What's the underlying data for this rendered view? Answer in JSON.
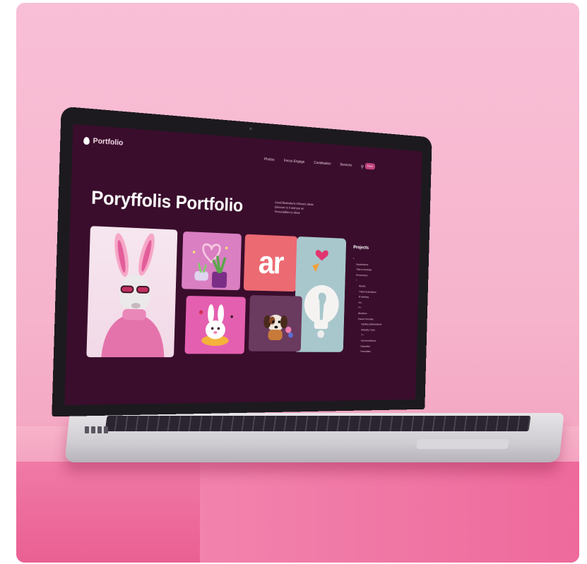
{
  "site": {
    "brand": "Portfolio",
    "nav": [
      "Photos",
      "Focus Engage",
      "Contribution",
      "Services"
    ],
    "nav_icons": [
      "search-icon",
      "shield-icon"
    ],
    "cta_label": "Share",
    "title": "Poryffolis Portfolio",
    "intro_lines": [
      "Good Illustrations Atheneic Ideas",
      "Discover to 3 and you an",
      "Personalities to Ideas"
    ],
    "tiles": [
      {
        "name": "bunny-sweater-tile",
        "bg": "#f2d9e7"
      },
      {
        "name": "heart-plant-tile",
        "bg": "#d97fc2"
      },
      {
        "name": "ar-tile",
        "text": "ar",
        "bg": "#ec6a72"
      },
      {
        "name": "lightbulb-tile",
        "bg": "#a8c7cc"
      },
      {
        "name": "bunny-cake-tile",
        "bg": "#e45fb0"
      },
      {
        "name": "dog-tile",
        "bg": "#6a3a5f"
      }
    ],
    "sidebar": {
      "title": "Projects",
      "items": [
        {
          "label": "+",
          "level": 0
        },
        {
          "label": "Ilaustrations",
          "level": 1
        },
        {
          "label": "Thinch Illustrate",
          "level": 1
        },
        {
          "label": "Persontions",
          "level": 1
        },
        {
          "label": "+",
          "level": 1
        },
        {
          "label": "Illustra",
          "level": 2
        },
        {
          "label": "Thinki-Ilustrations",
          "level": 2
        },
        {
          "label": "Ill Idaviing",
          "level": 2
        },
        {
          "label": "Ins",
          "level": 2
        },
        {
          "label": "P+",
          "level": 2
        },
        {
          "label": "Illuxtions",
          "level": 2
        },
        {
          "label": "Pacwt Frennels",
          "level": 2
        },
        {
          "label": "Dysting Ilisthandleed",
          "level": 3
        },
        {
          "label": "Ralaslly Trose",
          "level": 3
        },
        {
          "label": "T+",
          "level": 3
        },
        {
          "label": "Innovestrations",
          "level": 3
        },
        {
          "label": "Disacilles",
          "level": 3
        },
        {
          "label": "Fanocities",
          "level": 3
        }
      ]
    }
  },
  "colors": {
    "screen_bg": "#3a0d2c",
    "accent": "#c2447e",
    "backdrop": "#f6b4cc"
  }
}
